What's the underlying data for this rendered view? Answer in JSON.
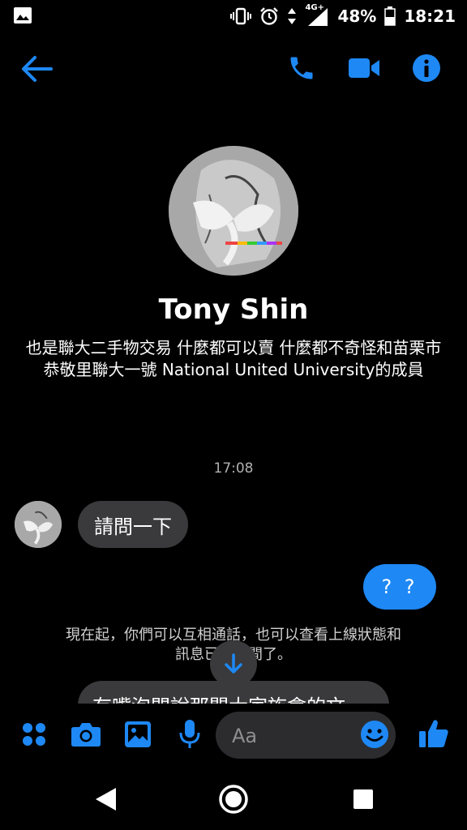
{
  "status_bar": {
    "network": "4G+",
    "battery": "48%",
    "time": "18:21"
  },
  "contact": {
    "name": "Tony Shin",
    "bio": "也是聯大二手物交易 什麼都可以賣 什麼都不奇怪和苗栗市恭敬里聯大一號 National United University的成員"
  },
  "conversation": {
    "timestamp": "17:08",
    "incoming_message": "請問一下",
    "outgoing_message": "? ?",
    "system_notice": "現在起，你們可以互相通話，也可以查看上線狀態和訊息已讀時間了。",
    "partial_message": "有嘴泡問說那間大家族會的文"
  },
  "composer": {
    "placeholder": "Aa"
  },
  "colors": {
    "accent": "#1e88f5",
    "bubble_gray": "#3a3a3c"
  }
}
